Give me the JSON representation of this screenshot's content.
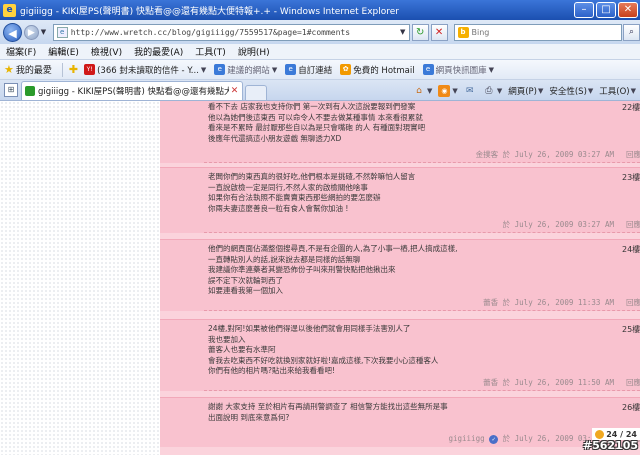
{
  "window": {
    "title": "gigiiigg - KIKI屋PS(聲明書) 快點看@@還有幾點大便特報+.+ - Windows Internet Explorer",
    "minimize": "–",
    "maximize": "□",
    "close": "✕"
  },
  "address_bar": {
    "url": "http://www.wretch.cc/blog/gigiiigg/7559517&page=1#comments",
    "search_placeholder": "Bing"
  },
  "menu": [
    "檔案(F)",
    "編輯(E)",
    "檢視(V)",
    "我的最愛(A)",
    "工具(T)",
    "說明(H)"
  ],
  "favorites_bar": {
    "label": "我的最愛",
    "links": [
      {
        "label": "(366 封未讀取的信件 - Y...",
        "icon": "yahoo-icon",
        "dim": false,
        "dropdown": true
      },
      {
        "label": "建議的網站",
        "icon": "ie-icon",
        "dim": true,
        "dropdown": true
      },
      {
        "label": "自訂連結",
        "icon": "ie-icon",
        "dim": false,
        "dropdown": false
      },
      {
        "label": "免費的 Hotmail",
        "icon": "msn-icon",
        "dim": false,
        "dropdown": false
      },
      {
        "label": "網頁快訊圖庫",
        "icon": "ie-icon",
        "dim": true,
        "dropdown": true
      }
    ]
  },
  "tabs": [
    {
      "title": "gigiiigg - KIKI屋PS(聲明書) 快點看@@還有幾點大..."
    }
  ],
  "command_bar": {
    "page": "網頁(P)",
    "safety": "安全性(S)",
    "tools": "工具(O)"
  },
  "comments": [
    {
      "number": "22樓",
      "text": "看不下去 店家我也支持你們 第一次到有人次這說要報到們發案\n他以為她們後這東西 可以命令人不要去做某種事情 本來看很累就\n看來是不累時 最討厭那些自以為是只會嘴砲 的人 有種面對現實吧\n後應年代還搞這小朋友遊戲 無聊透力XD",
      "author": "金撲客",
      "date": "於 July 26, 2009 03:27 AM",
      "reply": "回應"
    },
    {
      "number": "23樓",
      "text": "老闆你們的東西真的很好吃,他們根本是挑碴,不然幹嘛怕人留言\n一直說啟檢一定是同行,不然人家的啟檢關他啥事\n如果你有合法執照不能賣賣東西那些網拍的要怎麼辦\n你兩夫妻這麼善良一粒有食人會幫你加油 !",
      "author": "",
      "date": "於 July 26, 2009 03:27 AM",
      "reply": "回應"
    },
    {
      "number": "24樓",
      "text": "他們的網頁面佔滿整個搜尋頁,不是有企圖的人,為了小事一樁,把人搞成這樣,\n一直轉貼別人的話,說來說去都是同樣的話無聊\n我建議你準連藥者其變恐佈份子叫來刑警快點把他揪出來\n誤不定下次就輪到西了\n如要連看我第一個加入",
      "author": "蕾香",
      "date": "於 July 26, 2009 11:33 AM",
      "reply": "回應"
    },
    {
      "number": "25樓",
      "text": "24樓,對阿!如果被他們得逞以後他們就會用同樣手法害別人了\n我也要加入\n蕾客人也要有水準阿\n會我去吃東西不好吃就換別家就好啦!嘉成這樣,下次我要小心這種客人\n你們有他的相片嗎?貼出來給我看看吧!",
      "author": "蕾香",
      "date": "於 July 26, 2009 11:50 AM",
      "reply": "回應"
    },
    {
      "number": "26樓",
      "text": "謝謝 大家支持 至於相片有再請刑警調查了 相信警方能找出這些無所是事\n出面說明 到底來意爲何?",
      "author": "gigiiigg",
      "date": "於 July 26, 2009 03:45 PM",
      "reply": "回應"
    }
  ],
  "page_indicator": "24 / 24",
  "watermark": "#562105",
  "colors": {
    "comment_bg": "#f9c2cf",
    "page_bg": "#fbd3dc",
    "titlebar": "#1b4fb0"
  }
}
